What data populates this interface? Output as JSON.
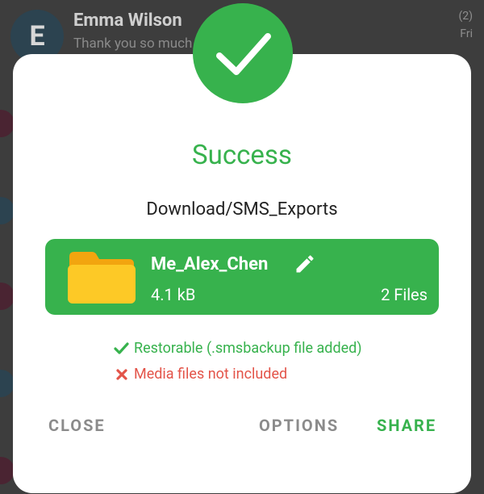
{
  "background": {
    "conversation": {
      "avatar_letter": "E",
      "name": "Emma Wilson",
      "preview": "Thank you so much",
      "count": "(2)",
      "day": "Fri"
    }
  },
  "dialog": {
    "badge_icon": "check-icon",
    "title": "Success",
    "path": "Download/SMS_Exports",
    "file": {
      "icon": "folder-icon",
      "name": "Me_Alex_Chen",
      "edit_icon": "pencil-icon",
      "size": "4.1 kB",
      "count": "2 Files"
    },
    "status": {
      "ok_icon": "check-icon",
      "ok_text": "Restorable (.smsbackup file added)",
      "bad_icon": "cross-icon",
      "bad_text": "Media files not included"
    },
    "buttons": {
      "close": "CLOSE",
      "options": "OPTIONS",
      "share": "SHARE"
    }
  },
  "colors": {
    "accent": "#37b24d",
    "error": "#e35449",
    "folder": "#fdc926",
    "dim_text": "#8b8b8b"
  }
}
